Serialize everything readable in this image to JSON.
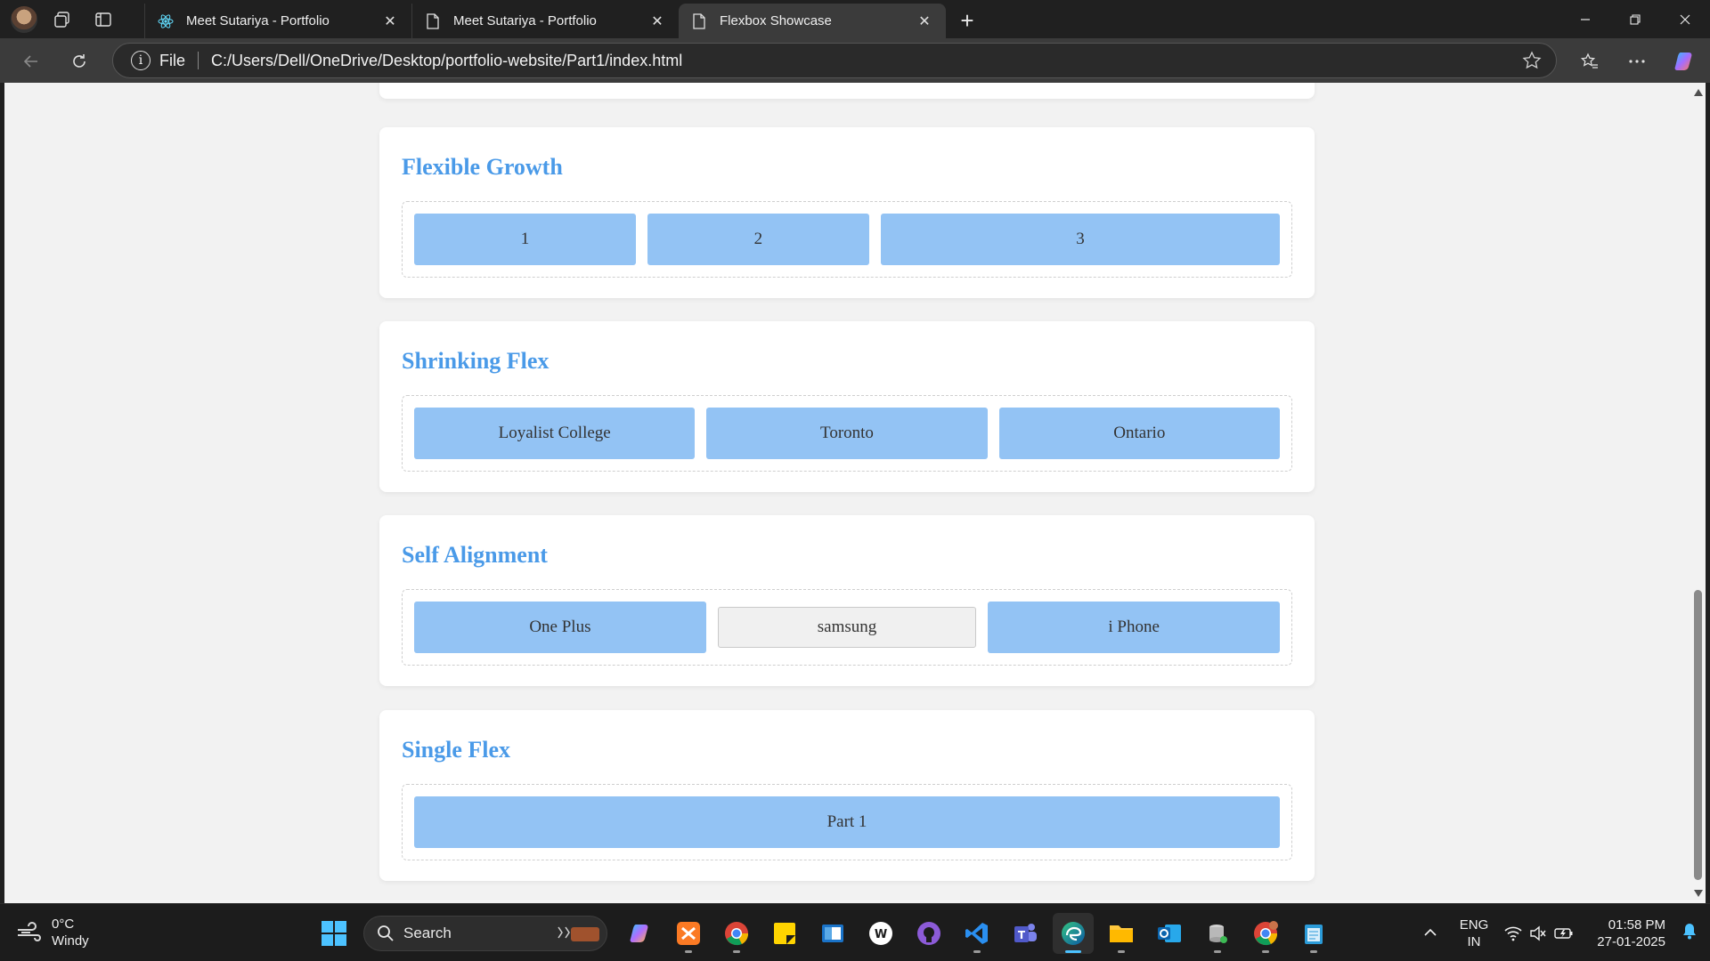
{
  "browser": {
    "tabs": [
      {
        "title": "Meet Sutariya - Portfolio",
        "icon": "react-icon",
        "active": false
      },
      {
        "title": "Meet Sutariya - Portfolio",
        "icon": "page-icon",
        "active": false
      },
      {
        "title": "Flexbox Showcase",
        "icon": "page-icon",
        "active": true
      }
    ],
    "close_glyph": "✕",
    "new_tab_glyph": "+",
    "address": {
      "scheme_label": "File",
      "url": "C:/Users/Dell/OneDrive/Desktop/portfolio-website/Part1/index.html"
    }
  },
  "page": {
    "sections": [
      {
        "title": "Flexible Growth",
        "items": [
          "1",
          "2",
          "3"
        ]
      },
      {
        "title": "Shrinking Flex",
        "items": [
          "Loyalist College",
          "Toronto",
          "Ontario"
        ]
      },
      {
        "title": "Self Alignment",
        "items": [
          "One Plus",
          "samsung",
          "i Phone"
        ]
      },
      {
        "title": "Single Flex",
        "items": [
          "Part 1"
        ]
      }
    ]
  },
  "taskbar": {
    "weather": {
      "temp": "0°C",
      "condition": "Windy"
    },
    "search_label": "Search",
    "apps": [
      "copilot-icon",
      "xampp-icon",
      "chrome-icon",
      "sticky-notes-icon",
      "whiteboard-icon",
      "word-app-icon",
      "github-icon",
      "vscode-icon",
      "teams-icon",
      "edge-icon",
      "file-explorer-icon",
      "outlook-icon",
      "db-tool-icon",
      "chrome-profile-icon",
      "notepad-icon"
    ],
    "language": {
      "line1": "ENG",
      "line2": "IN"
    },
    "clock": {
      "time": "01:58 PM",
      "date": "27-01-2025"
    }
  },
  "colors": {
    "accent_title": "#4a9ae8",
    "flex_item": "#93c3f4",
    "edge_active": "#4cc2ff"
  }
}
